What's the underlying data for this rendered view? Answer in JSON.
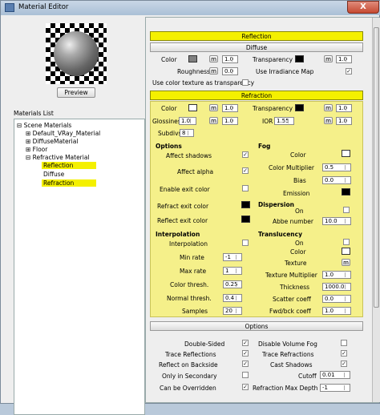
{
  "window": {
    "title": "Material Editor",
    "close": "X"
  },
  "left": {
    "preview_button": "Preview",
    "materials_list_label": "Materials List",
    "tree": [
      {
        "label": "Scene Materials",
        "selected": false
      },
      {
        "label": "Default_VRay_Material",
        "selected": false
      },
      {
        "label": "DiffuseMaterial",
        "selected": false
      },
      {
        "label": "Floor",
        "selected": false
      },
      {
        "label": "Refractive Material",
        "selected": false
      },
      {
        "label": "Reflection",
        "selected": true
      },
      {
        "label": "Diffuse",
        "selected": false
      },
      {
        "label": "Refraction",
        "selected": true
      }
    ]
  },
  "reflection": {
    "header": "Reflection"
  },
  "diffuse": {
    "header": "Diffuse",
    "color_label": "Color",
    "color_swatch": "#808080",
    "color_m": "m",
    "color_value": "1.0",
    "transparency_label": "Transparency",
    "transparency_swatch": "#000000",
    "transparency_m": "m",
    "transparency_value": "1.0",
    "roughness_label": "Roughness",
    "roughness_m": "m",
    "roughness_value": "0.0",
    "irradiance_label": "Use Irradiance Map",
    "irradiance_checked": "✓",
    "color_tex_label": "Use color texture as transparency"
  },
  "refraction": {
    "header": "Refraction",
    "color_label": "Color",
    "color_swatch": "#ffffff",
    "color_m": "m",
    "color_value": "1.0",
    "transparency_label": "Transparency",
    "transparency_swatch": "#000000",
    "transparency_m": "m",
    "transparency_value": "1.0",
    "glossiness_label": "Glossiness",
    "glossiness_value": "1.0",
    "glossiness_m": "m",
    "glossiness_value2": "1.0",
    "ior_label": "IOR",
    "ior_value": "1.55",
    "ior_m": "m",
    "ior_value2": "1.0",
    "subdivs_label": "Subdivs",
    "subdivs_value": "8",
    "options_title": "Options",
    "affect_shadows": "Affect shadows",
    "affect_shadows_check": "✓",
    "affect_alpha": "Affect alpha",
    "affect_alpha_check": "✓",
    "enable_exit": "Enable exit color",
    "refract_exit": "Refract exit color",
    "reflect_exit": "Reflect exit color",
    "fog_title": "Fog",
    "fog_color": "Color",
    "fog_mult": "Color Multiplier",
    "fog_mult_value": "0.5",
    "fog_bias": "Bias",
    "fog_bias_value": "0.0",
    "fog_emission": "Emission",
    "dispersion_title": "Dispersion",
    "dispersion_on": "On",
    "abbe_label": "Abbe number",
    "abbe_value": "10.0",
    "interp_title": "Interpolation",
    "interp_label": "Interpolation",
    "min_rate": "Min rate",
    "min_rate_value": "-1",
    "max_rate": "Max rate",
    "max_rate_value": "1",
    "color_thresh": "Color thresh.",
    "color_thresh_value": "0.25",
    "normal_thresh": "Normal thresh.",
    "normal_thresh_value": "0.4",
    "samples": "Samples",
    "samples_value": "20",
    "transl_title": "Translucency",
    "transl_on": "On",
    "transl_color": "Color",
    "texture": "Texture",
    "texture_m": "m",
    "tex_mult": "Texture Multiplier",
    "tex_mult_value": "1.0",
    "thickness": "Thickness",
    "thickness_value": "1000.0",
    "scatter": "Scatter coeff",
    "scatter_value": "0.0",
    "fwd": "Fwd/bck coeff",
    "fwd_value": "1.0"
  },
  "options": {
    "header": "Options",
    "double_sided": "Double-Sided",
    "double_sided_check": "✓",
    "trace_refl": "Trace Reflections",
    "trace_refl_check": "✓",
    "reflect_backside": "Reflect on Backside",
    "reflect_backside_check": "✓",
    "only_secondary": "Only in Secondary",
    "can_override": "Can be Overridden",
    "can_override_check": "✓",
    "disable_fog": "Disable Volume Fog",
    "trace_refr": "Trace Refractions",
    "trace_refr_check": "✓",
    "cast_shadows": "Cast Shadows",
    "cast_shadows_check": "✓",
    "cutoff": "Cutoff",
    "cutoff_value": "0.01",
    "refr_max_depth": "Refraction Max Depth",
    "refr_max_depth_value": "-1"
  }
}
